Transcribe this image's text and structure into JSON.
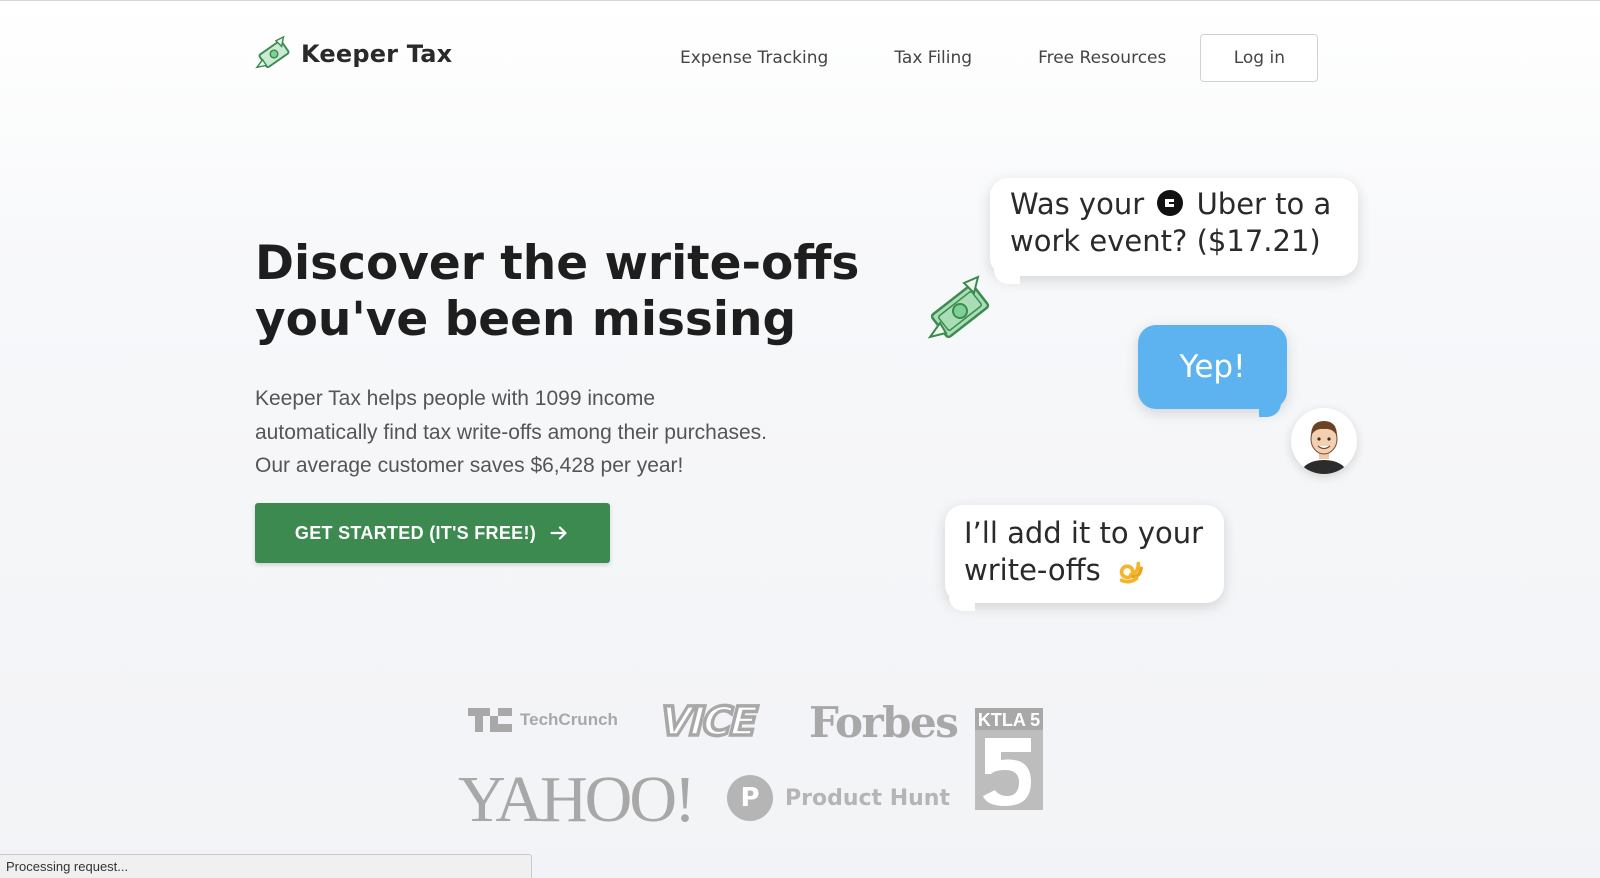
{
  "brand": {
    "name": "Keeper Tax"
  },
  "nav": {
    "items": [
      {
        "label": "Expense Tracking"
      },
      {
        "label": "Tax Filing"
      },
      {
        "label": "Free Resources"
      }
    ],
    "login_label": "Log in"
  },
  "hero": {
    "title_line1": "Discover the write-offs",
    "title_line2": "you've been missing",
    "desc_line1": "Keeper Tax helps people with 1099 income",
    "desc_line2": "automatically find tax write-offs among their purchases.",
    "desc_line3": "Our average customer saves $6,428 per year!",
    "cta_label": "GET STARTED (IT'S FREE!)"
  },
  "chat": {
    "q_part1": "Was your",
    "q_part2": "Uber to a",
    "q_part3": "work event? ($17.21)",
    "reply": "Yep!",
    "confirm_line1": "I’ll add it to your",
    "confirm_line2": "write-offs"
  },
  "press": {
    "techcrunch_text": "TechCrunch",
    "vice": "VICE",
    "forbes": "Forbes",
    "ktla": "KTLA 5",
    "yahoo": "YAHOO!",
    "producthunt_letter": "P",
    "producthunt_text": "Product Hunt"
  },
  "status": {
    "text": "Processing request..."
  },
  "colors": {
    "accent_green": "#3c8a4f",
    "chat_blue": "#5db3f0"
  },
  "icons": [
    "money-wings-logo-icon",
    "uber-icon",
    "money-wings-icon",
    "user-avatar",
    "ok-hand-emoji-icon",
    "arrow-right-icon"
  ]
}
